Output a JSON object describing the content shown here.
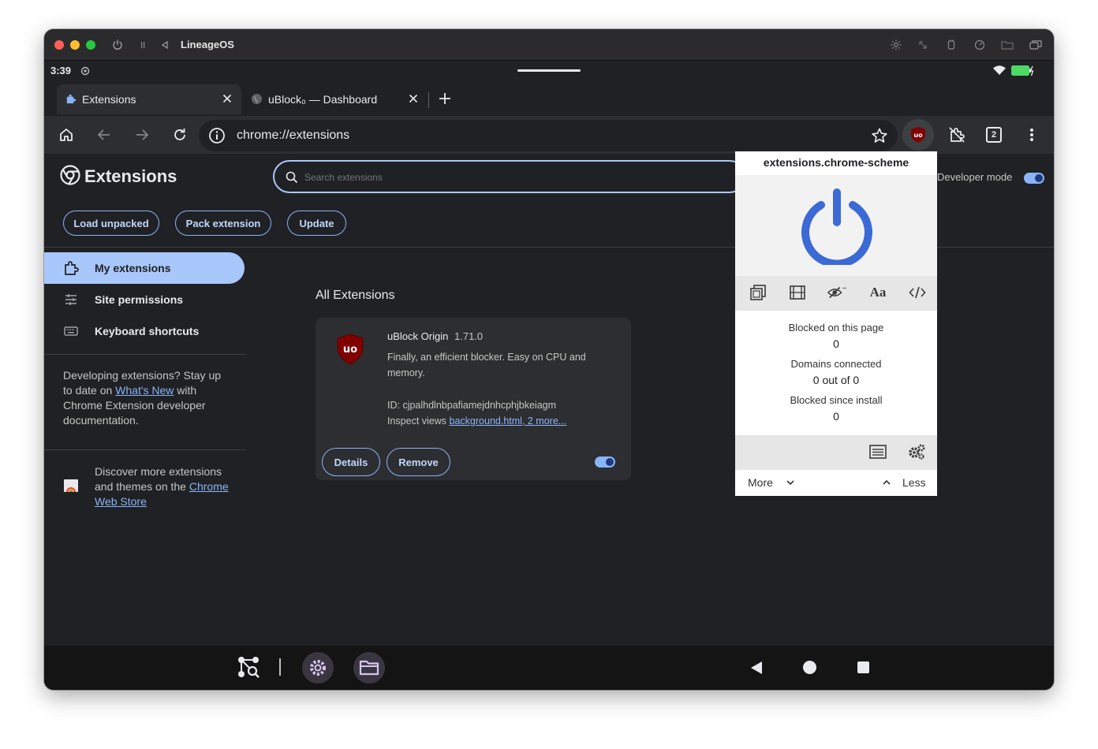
{
  "window": {
    "title": "LineageOS"
  },
  "status": {
    "time": "3:39"
  },
  "tabs": [
    {
      "label": "Extensions"
    },
    {
      "label": "uBlock₀ — Dashboard"
    }
  ],
  "omnibox": {
    "url": "chrome://extensions"
  },
  "page": {
    "title": "Extensions",
    "search_placeholder": "Search extensions",
    "developer_mode_label": "Developer mode",
    "developer_mode_on": true,
    "actions": {
      "load_unpacked": "Load unpacked",
      "pack_extension": "Pack extension",
      "update": "Update"
    }
  },
  "sidebar": {
    "items": [
      {
        "label": "My extensions",
        "active": true
      },
      {
        "label": "Site permissions"
      },
      {
        "label": "Keyboard shortcuts"
      }
    ],
    "promo": {
      "text1": "Developing extensions? Stay up to date on ",
      "link": "What's New",
      "text2": " with Chrome Extension developer documentation."
    },
    "store": {
      "text": "Discover more extensions and themes on the ",
      "link": "Chrome Web Store"
    }
  },
  "main": {
    "section_title": "All Extensions",
    "card": {
      "name": "uBlock Origin",
      "version": "1.71.0",
      "description": "Finally, an efficient blocker. Easy on CPU and memory.",
      "id_line": "ID: cjpalhdlnbpafiamejdnhcphjbkeiagm",
      "inspect_label": "Inspect views ",
      "inspect_link": "background.html, 2 more...",
      "details_label": "Details",
      "remove_label": "Remove",
      "enabled": true
    }
  },
  "popup": {
    "hostname": "extensions.chrome-scheme",
    "stats": [
      {
        "label": "Blocked on this page",
        "value": "0"
      },
      {
        "label": "Domains connected",
        "value": "0 out of 0"
      },
      {
        "label": "Blocked since install",
        "value": "0"
      }
    ],
    "more_label": "More",
    "less_label": "Less",
    "power_color": "#3b6ad6"
  },
  "toolbar": {
    "tab_count": "2"
  },
  "colors": {
    "accent": "#8ab4f8",
    "selected_bg": "#a8c7fa",
    "ublock_red": "#800000"
  }
}
